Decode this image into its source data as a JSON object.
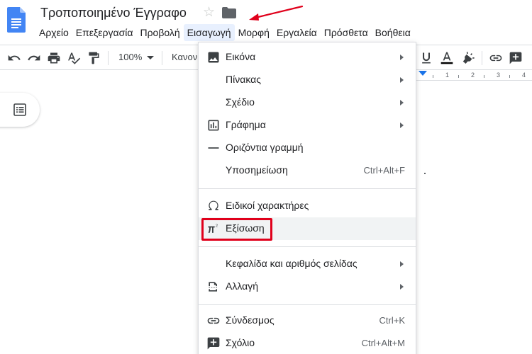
{
  "title": {
    "text": "Τροποποιημένο Έγγραφο",
    "star_icon": "star-icon",
    "folder_icon": "folder-icon"
  },
  "menubar": [
    {
      "id": "file",
      "label": "Αρχείο"
    },
    {
      "id": "edit",
      "label": "Επεξεργασία"
    },
    {
      "id": "view",
      "label": "Προβολή"
    },
    {
      "id": "insert",
      "label": "Εισαγωγή",
      "active": true
    },
    {
      "id": "format",
      "label": "Μορφή"
    },
    {
      "id": "tools",
      "label": "Εργαλεία"
    },
    {
      "id": "addons",
      "label": "Πρόσθετα"
    },
    {
      "id": "help",
      "label": "Βοήθεια"
    }
  ],
  "toolbar": {
    "zoom": "100%",
    "style_truncated": "Κανονι",
    "left_icons": [
      "undo-icon",
      "redo-icon",
      "print-icon",
      "spellcheck-icon",
      "paint-format-icon"
    ],
    "right_icons": [
      "underline-icon",
      "text-color-icon",
      "highlight-icon",
      "link-icon",
      "add-comment-icon"
    ]
  },
  "ruler": {
    "numbers": [
      "1",
      "2",
      "3",
      "4"
    ]
  },
  "insert_menu": {
    "items": [
      {
        "id": "image",
        "label": "Εικόνα",
        "icon": "image-icon",
        "submenu": true
      },
      {
        "id": "table",
        "label": "Πίνακας",
        "submenu": true
      },
      {
        "id": "drawing",
        "label": "Σχέδιο",
        "submenu": true
      },
      {
        "id": "chart",
        "label": "Γράφημα",
        "icon": "chart-icon",
        "submenu": true
      },
      {
        "id": "hline",
        "label": "Οριζόντια γραμμή",
        "icon": "horizontal-line-icon"
      },
      {
        "id": "footnote",
        "label": "Υποσημείωση",
        "shortcut": "Ctrl+Alt+F"
      },
      {
        "id": "special",
        "label": "Ειδικοί χαρακτήρες",
        "icon": "omega-icon"
      },
      {
        "id": "equation",
        "label": "Εξίσωση",
        "icon": "pi-equation-icon",
        "hover": true
      },
      {
        "id": "header",
        "label": "Κεφαλίδα και αριθμός σελίδας",
        "submenu": true
      },
      {
        "id": "break",
        "label": "Αλλαγή",
        "icon": "page-break-icon",
        "submenu": true
      },
      {
        "id": "link",
        "label": "Σύνδεσμος",
        "icon": "link-icon",
        "shortcut": "Ctrl+K"
      },
      {
        "id": "comment",
        "label": "Σχόλιο",
        "icon": "comment-add-icon",
        "shortcut": "Ctrl+Alt+M"
      }
    ]
  },
  "colors": {
    "annotation_red": "#e0001b",
    "docs_blue": "#4285f4",
    "text_color_bar": "#000000",
    "ruler_marker": "#1a73e8"
  }
}
